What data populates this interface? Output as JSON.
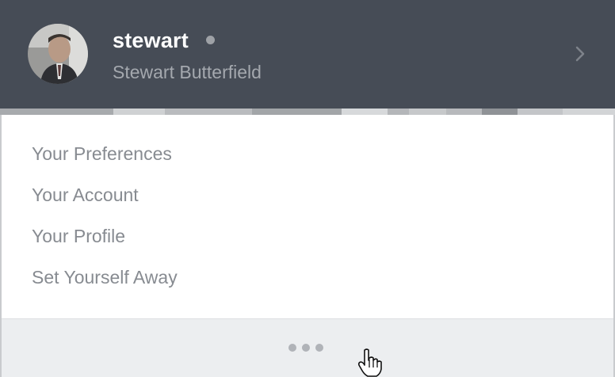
{
  "profile": {
    "username": "stewart",
    "full_name": "Stewart Butterfield",
    "presence_status": "away",
    "presence_color": "#9ea1a6"
  },
  "header": {
    "background": "#464c56",
    "chevron_icon": "chevron-right-icon"
  },
  "menu": {
    "items": [
      {
        "label": "Your Preferences"
      },
      {
        "label": "Your Account"
      },
      {
        "label": "Your Profile"
      },
      {
        "label": "Set Yourself Away"
      }
    ]
  },
  "footer": {
    "more_icon": "ellipsis-icon"
  },
  "cursor": {
    "icon": "hand-pointer-icon"
  }
}
